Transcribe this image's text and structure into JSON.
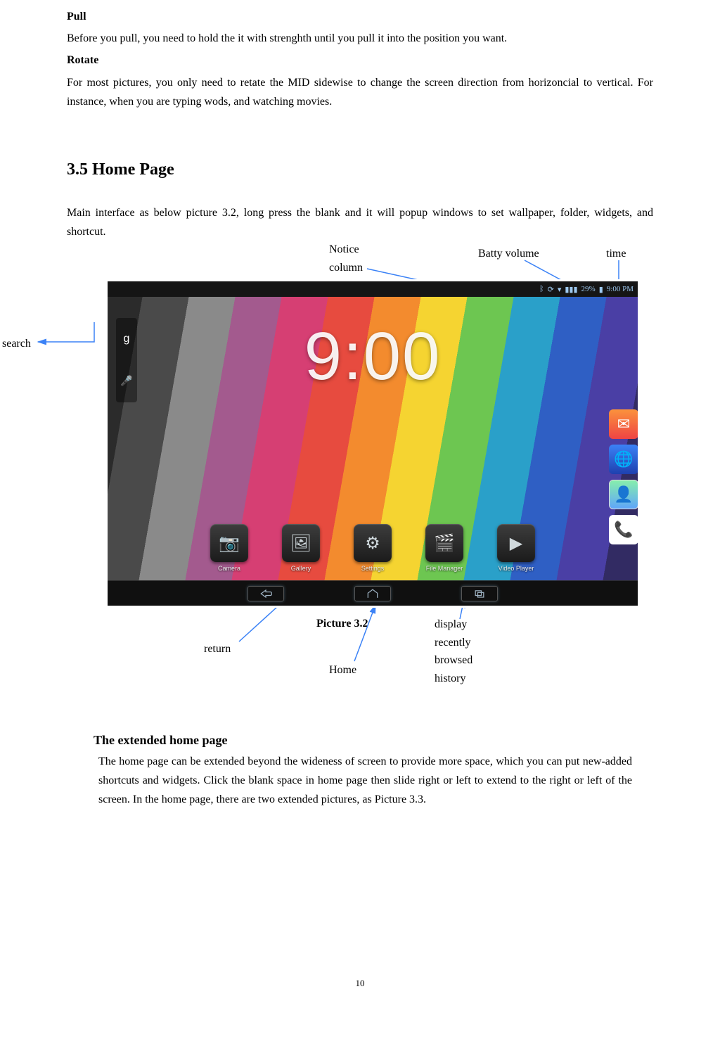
{
  "text": {
    "pull_heading": "Pull",
    "pull_body": "Before you pull, you need to hold the it with strenghth until you pull it into the position you want.",
    "rotate_heading": "Rotate",
    "rotate_body": "For most pictures, you only need to retate the MID sidewise to change the screen direction from horizoncial to vertical. For instance, when you are typing wods, and watching movies.",
    "home_title": "3.5 Home Page",
    "home_body": "Main interface as below picture 3.2, long press the blank and it will popup windows to set wallpaper, folder, widgets, and shortcut.",
    "ext_title": "The extended home page",
    "ext_body": "The home page can be extended beyond the wideness of screen to provide more space, which you can put new-added shortcuts and widgets. Click the blank space in home page then slide right or left to extend to the right or left of the screen. In the home page, there are two extended pictures, as Picture 3.3.",
    "page_number": "10"
  },
  "annotations": {
    "search": "search",
    "notice": "Notice column",
    "batty": "Batty volume",
    "time": "time",
    "return": "return",
    "home": "Home",
    "recent": "display recently browsed history",
    "caption": "Picture 3.2"
  },
  "screenshot": {
    "statusbar": {
      "battery_text": "29%",
      "time": "9:00 PM"
    },
    "clock": "9:00",
    "dock": [
      {
        "name": "Camera",
        "icon": "📷"
      },
      {
        "name": "Gallery",
        "icon": "🖼"
      },
      {
        "name": "Settings",
        "icon": "⚙"
      },
      {
        "name": "File Manager",
        "icon": "🎬"
      },
      {
        "name": "Video Player",
        "icon": "▶"
      }
    ]
  }
}
